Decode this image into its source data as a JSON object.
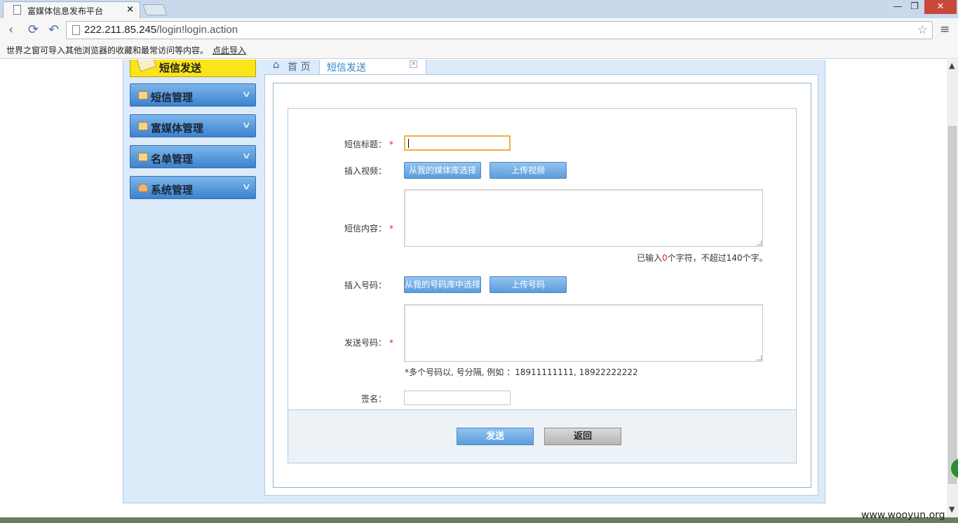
{
  "browser": {
    "tab_title": "富媒体信息发布平台",
    "tab_close": "×",
    "url_host": "222.211.85.245",
    "url_path": "/login!login.action",
    "bookmark_hint": "世界之窗可导入其他浏览器的收藏和最常访问等内容。",
    "bookmark_import": "点此导入",
    "window_controls": {
      "minimize": "—",
      "maximize": "❐",
      "close": "✕"
    },
    "nav_icons": {
      "back": "‹",
      "reload": "⟳",
      "undo": "↶",
      "star": "☆",
      "menu": "≡"
    }
  },
  "sidebar": {
    "active_item": "短信发送",
    "items": [
      {
        "label": "短信管理",
        "icon": "edit-icon"
      },
      {
        "label": "富媒体管理",
        "icon": "edit-icon"
      },
      {
        "label": "名单管理",
        "icon": "edit-icon"
      },
      {
        "label": "系统管理",
        "icon": "users-icon"
      }
    ],
    "chevron": "∨"
  },
  "content_tabs": {
    "home": "首 页",
    "home_icon": "⌂",
    "sms": "短信发送",
    "sms_close": "×"
  },
  "form": {
    "title_label": "短信标题：",
    "video_label": "插入视频：",
    "video_select_btn": "从我的媒体库选择",
    "video_upload_btn": "上传视频",
    "content_label": "短信内容：",
    "counter_prefix": "已输入",
    "counter_value": "0",
    "counter_suffix": "个字符，不超过140个字。",
    "number_label": "插入号码：",
    "number_select_btn": "从我的号码库中选择",
    "number_upload_btn": "上传号码",
    "send_numbers_label": "发送号码：",
    "send_numbers_note": "*多个号码以, 号分隔, 例如 ：18911111111, 18922222222",
    "signature_label": "签名：",
    "required_mark": "*"
  },
  "actions": {
    "send": "发送",
    "back": "返回"
  },
  "watermark": "www.wooyun.org",
  "colors": {
    "accent_blue": "#5b9ddd",
    "menu_highlight": "#fbe418",
    "required": "#d62a2a"
  }
}
